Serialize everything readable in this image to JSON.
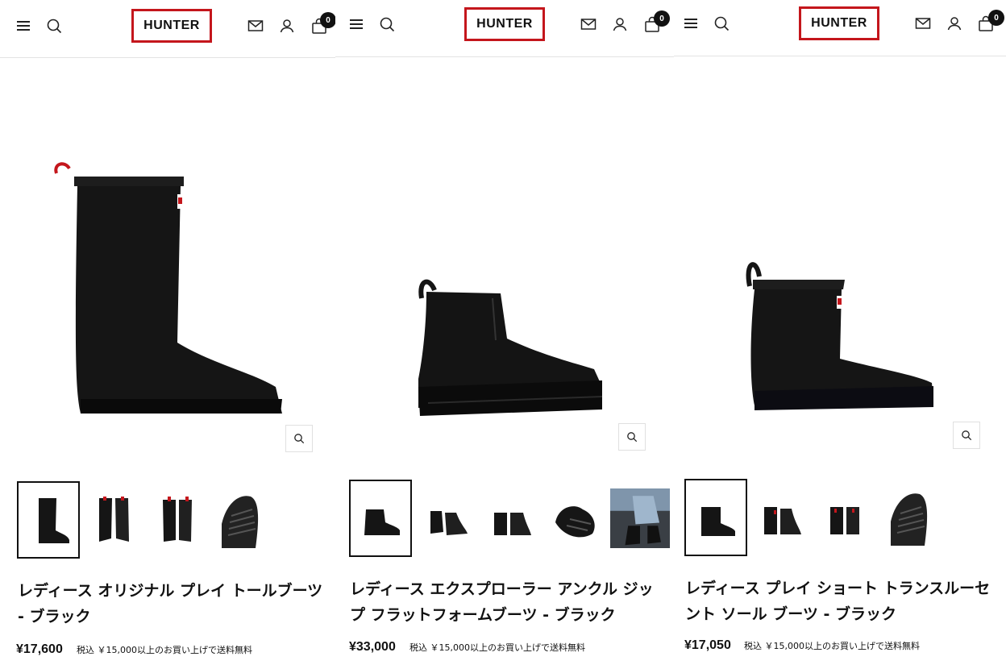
{
  "brand": {
    "logo_text": "HUNTER",
    "accent": "#c4161c"
  },
  "header_icons": [
    "menu-icon",
    "search-icon",
    "mail-icon",
    "account-icon",
    "bag-icon"
  ],
  "panels": [
    {
      "cart_count": "0",
      "title": "レディース オリジナル プレイ トールブーツ - ブラック",
      "price": "¥17,600",
      "tax_note": "税込 ￥15,000以上のお買い上げで送料無料",
      "thumbnails": [
        "tall-boot-side",
        "tall-boot-pair-back",
        "tall-boot-pair-front",
        "tall-boot-sole"
      ]
    },
    {
      "cart_count": "0",
      "title": "レディース エクスプローラー アンクル ジップ フラットフォームブーツ - ブラック",
      "price": "¥33,000",
      "tax_note": "税込 ￥15,000以上のお買い上げで送料無料",
      "thumbnails": [
        "zip-boot-side",
        "zip-boot-pair",
        "zip-boot-pair-back",
        "zip-boot-sole",
        "zip-boot-worn-photo"
      ]
    },
    {
      "cart_count": "0",
      "title": "レディース プレイ ショート トランスルーセント ソール ブーツ - ブラック",
      "price": "¥17,050",
      "tax_note": "税込 ￥15,000以上のお買い上げで送料無料",
      "thumbnails": [
        "short-boot-side",
        "short-boot-pair",
        "short-boot-pair-back",
        "short-boot-sole"
      ]
    }
  ]
}
